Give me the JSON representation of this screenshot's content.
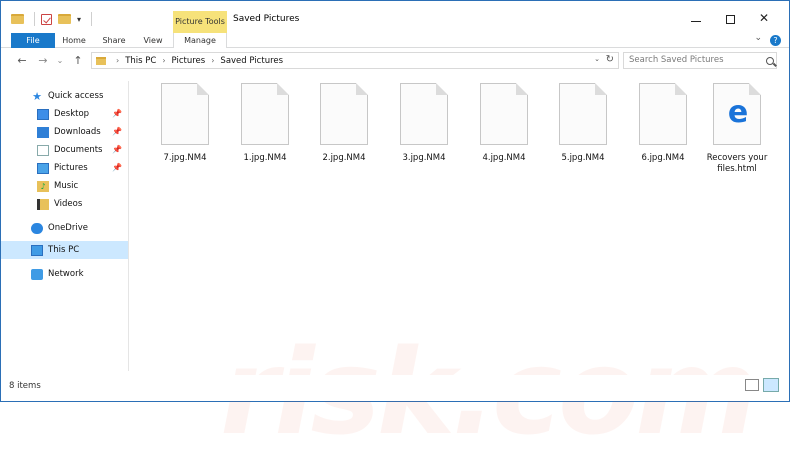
{
  "window": {
    "title": "Saved Pictures",
    "context_group": "Picture Tools"
  },
  "ribbon": {
    "tabs": [
      "File",
      "Home",
      "Share",
      "View",
      "Manage"
    ]
  },
  "nav": {
    "breadcrumb": [
      "This PC",
      "Pictures",
      "Saved Pictures"
    ],
    "search_placeholder": "Search Saved Pictures"
  },
  "sidebar": {
    "items": [
      {
        "label": "Quick access",
        "icon": "star-icon"
      },
      {
        "label": "Desktop",
        "icon": "desktop-icon",
        "pinned": true
      },
      {
        "label": "Downloads",
        "icon": "downloads-icon",
        "pinned": true
      },
      {
        "label": "Documents",
        "icon": "documents-icon",
        "pinned": true
      },
      {
        "label": "Pictures",
        "icon": "pictures-icon",
        "pinned": true
      },
      {
        "label": "Music",
        "icon": "music-icon"
      },
      {
        "label": "Videos",
        "icon": "videos-icon"
      },
      {
        "label": "OneDrive",
        "icon": "cloud-icon"
      },
      {
        "label": "This PC",
        "icon": "computer-icon",
        "selected": true
      },
      {
        "label": "Network",
        "icon": "network-icon"
      }
    ]
  },
  "files": [
    {
      "name": "7.jpg.NM4",
      "icon": "blank-file-icon"
    },
    {
      "name": "1.jpg.NM4",
      "icon": "blank-file-icon"
    },
    {
      "name": "2.jpg.NM4",
      "icon": "blank-file-icon"
    },
    {
      "name": "3.jpg.NM4",
      "icon": "blank-file-icon"
    },
    {
      "name": "4.jpg.NM4",
      "icon": "blank-file-icon"
    },
    {
      "name": "5.jpg.NM4",
      "icon": "blank-file-icon"
    },
    {
      "name": "6.jpg.NM4",
      "icon": "blank-file-icon"
    },
    {
      "name": "Recovers your files.html",
      "icon": "edge-html-icon"
    }
  ],
  "watermark": {
    "logo": "PC",
    "text": "risk.com"
  },
  "status": {
    "item_count": "8 items"
  },
  "colors": {
    "accent": "#1979ca",
    "context_tab": "#f6e27a",
    "selection": "#cce8ff"
  }
}
